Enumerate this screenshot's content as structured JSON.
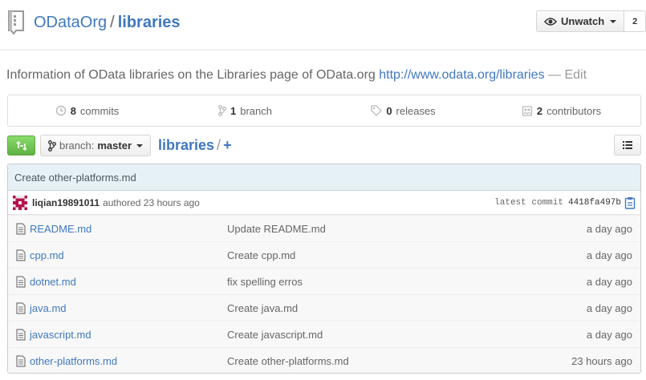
{
  "repo": {
    "owner": "ODataOrg",
    "separator": "/",
    "name": "libraries",
    "icon": "repo-icon"
  },
  "watch": {
    "label": "Unwatch",
    "count": "2",
    "icon": "eye-icon"
  },
  "description": {
    "text": "Information of OData libraries on the Libraries page of OData.org",
    "url": "http://www.odata.org/libraries",
    "dash": "—",
    "edit": "Edit"
  },
  "stats": [
    {
      "count": "8",
      "label": "commits",
      "icon": "history-icon"
    },
    {
      "count": "1",
      "label": "branch",
      "icon": "branch-icon"
    },
    {
      "count": "0",
      "label": "releases",
      "icon": "tag-icon"
    },
    {
      "count": "2",
      "label": "contributors",
      "icon": "organization-icon"
    }
  ],
  "toolbar": {
    "branch_prefix": "branch:",
    "branch_name": "master",
    "path_repo": "libraries",
    "path_slash": "/",
    "path_plus": "+"
  },
  "commit": {
    "message": "Create other-platforms.md",
    "author": "liqian19891011",
    "authored": "authored 23 hours ago",
    "latest_label": "latest commit",
    "sha": "4418fa497b"
  },
  "files": [
    {
      "name": "README.md",
      "message": "Update README.md",
      "age": "a day ago"
    },
    {
      "name": "cpp.md",
      "message": "Create cpp.md",
      "age": "a day ago"
    },
    {
      "name": "dotnet.md",
      "message": "fix spelling erros",
      "age": "a day ago"
    },
    {
      "name": "java.md",
      "message": "Create java.md",
      "age": "a day ago"
    },
    {
      "name": "javascript.md",
      "message": "Create javascript.md",
      "age": "a day ago"
    },
    {
      "name": "other-platforms.md",
      "message": "Create other-platforms.md",
      "age": "23 hours ago"
    }
  ],
  "colors": {
    "link": "#4078c0",
    "green": "#60b044",
    "commit_bg": "#e6f1f6"
  }
}
